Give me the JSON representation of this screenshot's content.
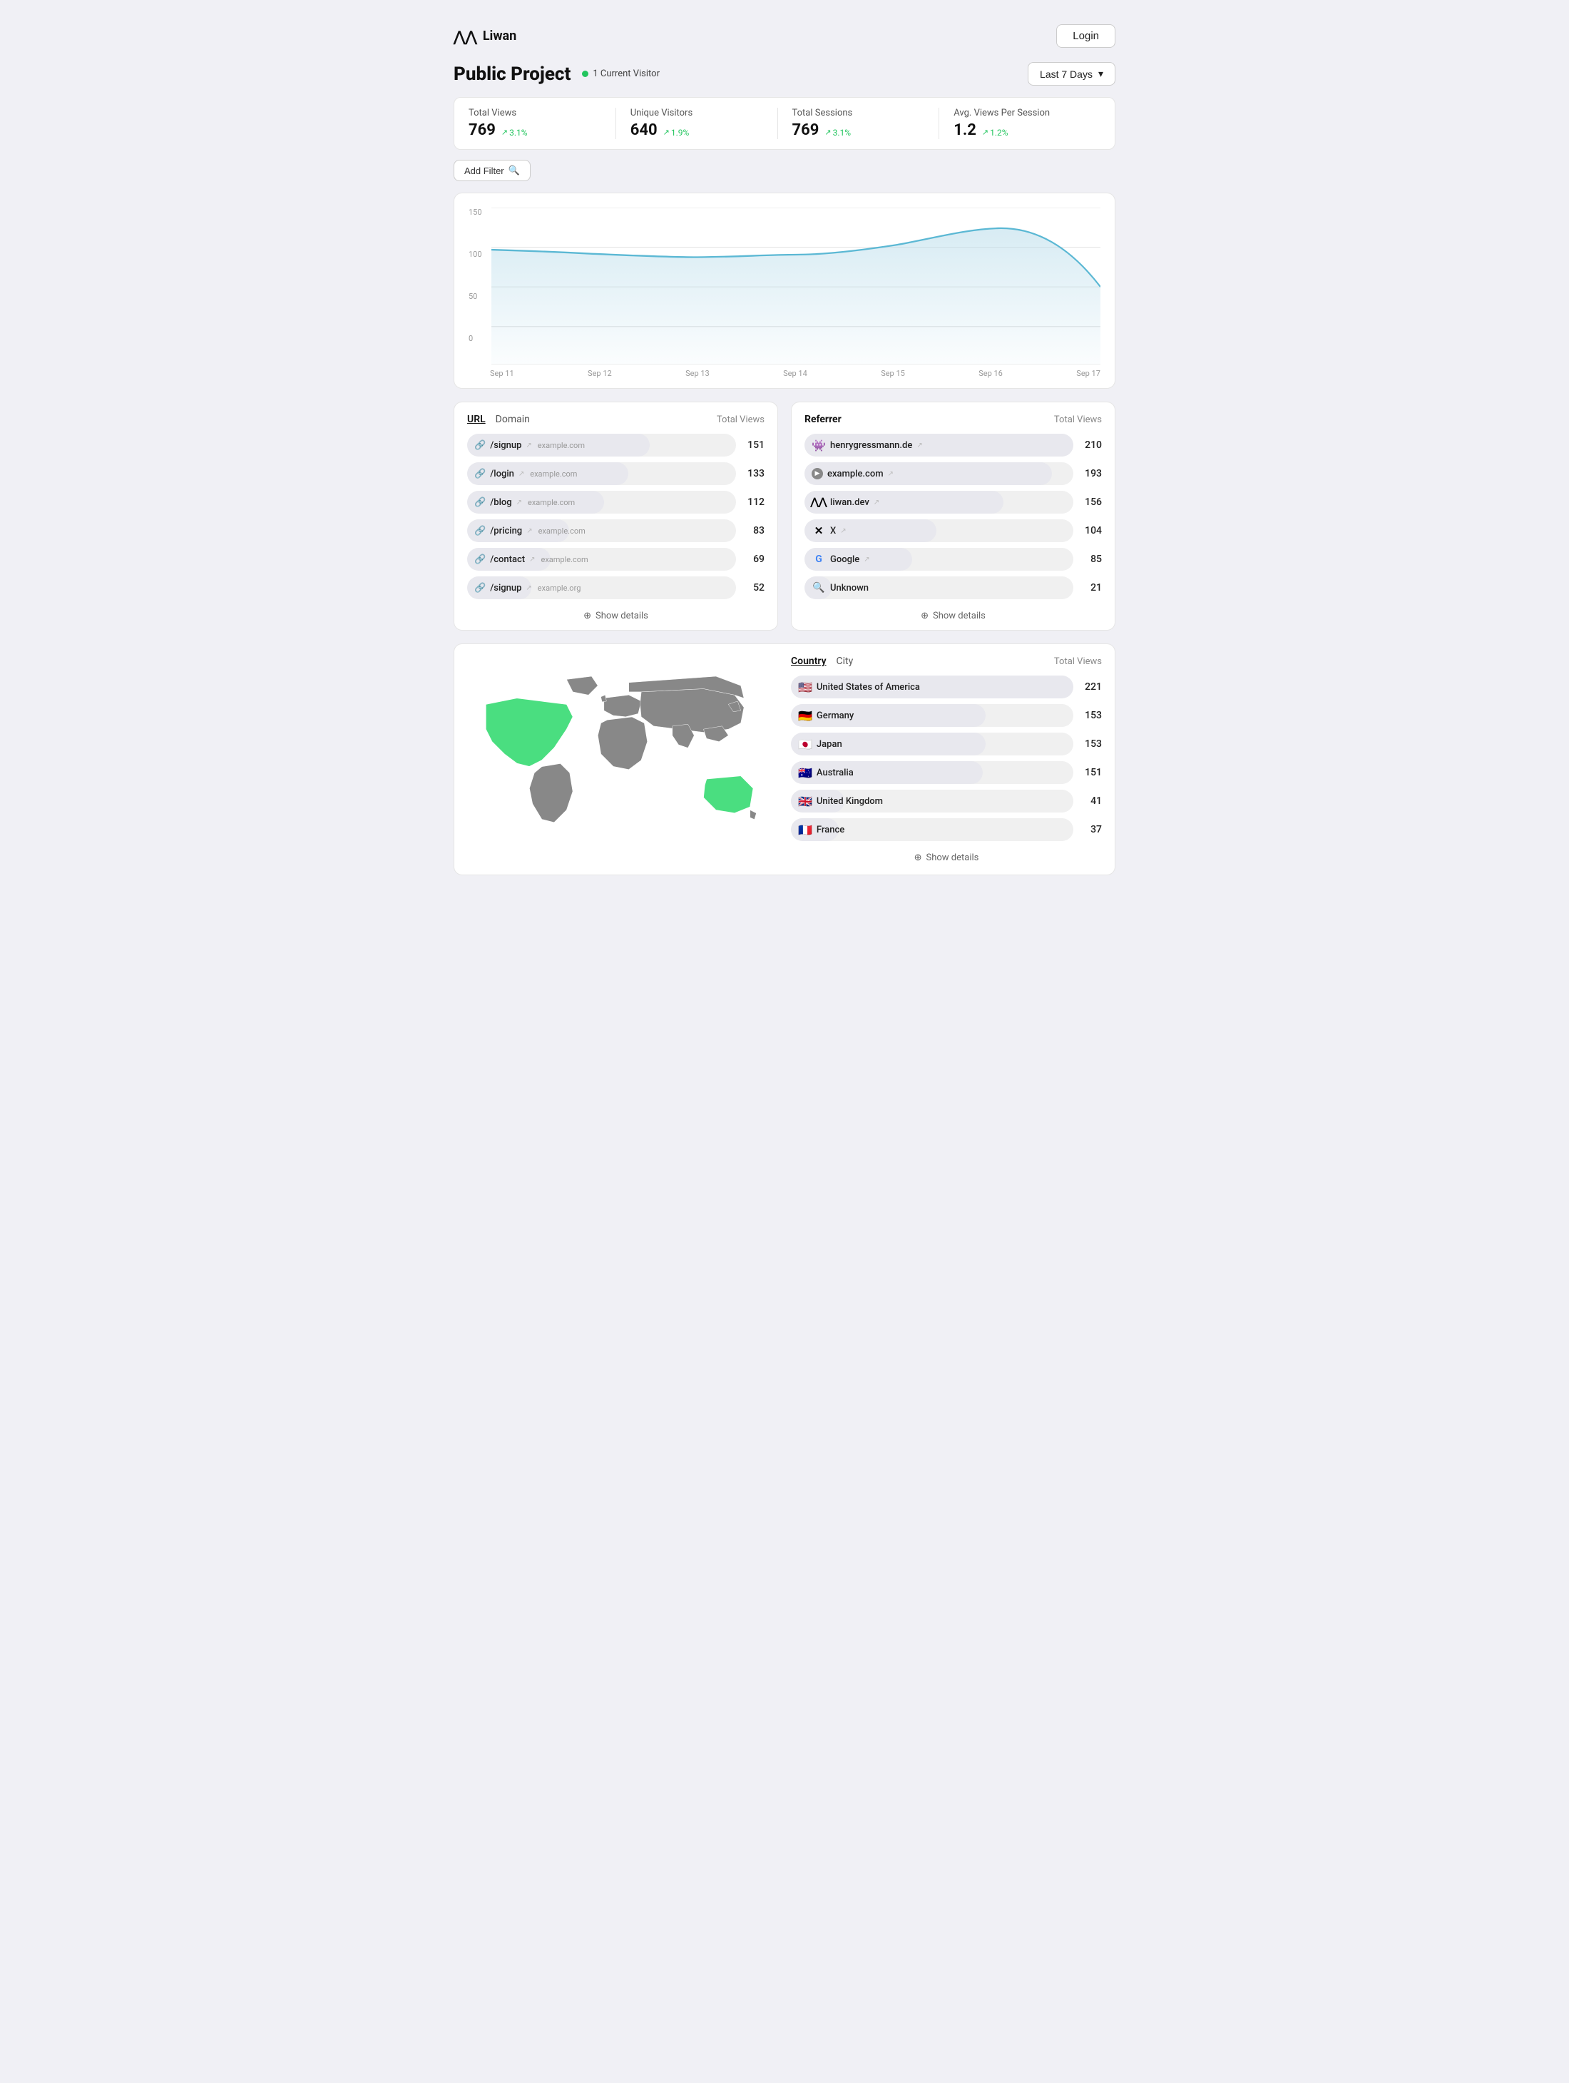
{
  "header": {
    "logo_text": "Liwan",
    "login_label": "Login"
  },
  "page": {
    "title": "Public Project",
    "visitor_count": "1 Current Visitor",
    "date_range": "Last 7 Days"
  },
  "stats": [
    {
      "label": "Total Views",
      "value": "769",
      "change": "3.1%"
    },
    {
      "label": "Unique Visitors",
      "value": "640",
      "change": "1.9%"
    },
    {
      "label": "Total Sessions",
      "value": "769",
      "change": "3.1%"
    },
    {
      "label": "Avg. Views Per Session",
      "value": "1.2",
      "change": "1.2%"
    }
  ],
  "filter": {
    "label": "Add Filter"
  },
  "chart": {
    "y_labels": [
      "150",
      "100",
      "50",
      "0"
    ],
    "x_labels": [
      "Sep 11",
      "Sep 12",
      "Sep 13",
      "Sep 14",
      "Sep 15",
      "Sep 16",
      "Sep 17"
    ]
  },
  "url_table": {
    "tabs": [
      "URL",
      "Domain"
    ],
    "col_label": "Total Views",
    "rows": [
      {
        "path": "/signup",
        "domain": "example.com",
        "count": "151",
        "pct": 68
      },
      {
        "path": "/login",
        "domain": "example.com",
        "count": "133",
        "pct": 60
      },
      {
        "path": "/blog",
        "domain": "example.com",
        "count": "112",
        "pct": 51
      },
      {
        "path": "/pricing",
        "domain": "example.com",
        "count": "83",
        "pct": 38
      },
      {
        "path": "/contact",
        "domain": "example.com",
        "count": "69",
        "pct": 31
      },
      {
        "path": "/signup",
        "domain": "example.org",
        "count": "52",
        "pct": 24
      }
    ],
    "show_details": "Show details"
  },
  "referrer_table": {
    "tab": "Referrer",
    "col_label": "Total Views",
    "rows": [
      {
        "name": "henrygressmann.de",
        "icon": "bug",
        "count": "210",
        "pct": 100
      },
      {
        "name": "example.com",
        "icon": "circle",
        "count": "193",
        "pct": 92
      },
      {
        "name": "liwan.dev",
        "icon": "liwan",
        "count": "156",
        "pct": 74
      },
      {
        "name": "X",
        "icon": "x",
        "count": "104",
        "pct": 49
      },
      {
        "name": "Google",
        "icon": "google",
        "count": "85",
        "pct": 40
      },
      {
        "name": "Unknown",
        "icon": "search",
        "count": "21",
        "pct": 10
      }
    ],
    "show_details": "Show details"
  },
  "geo_table": {
    "tabs": [
      "Country",
      "City"
    ],
    "col_label": "Total Views",
    "rows": [
      {
        "name": "United States of America",
        "flag": "🇺🇸",
        "count": "221",
        "pct": 100
      },
      {
        "name": "Germany",
        "flag": "🇩🇪",
        "count": "153",
        "pct": 69
      },
      {
        "name": "Japan",
        "flag": "🇯🇵",
        "count": "153",
        "pct": 69
      },
      {
        "name": "Australia",
        "flag": "🇦🇺",
        "count": "151",
        "pct": 68
      },
      {
        "name": "United Kingdom",
        "flag": "🇬🇧",
        "count": "41",
        "pct": 19
      },
      {
        "name": "France",
        "flag": "🇫🇷",
        "count": "37",
        "pct": 17
      }
    ],
    "show_details": "Show details"
  }
}
